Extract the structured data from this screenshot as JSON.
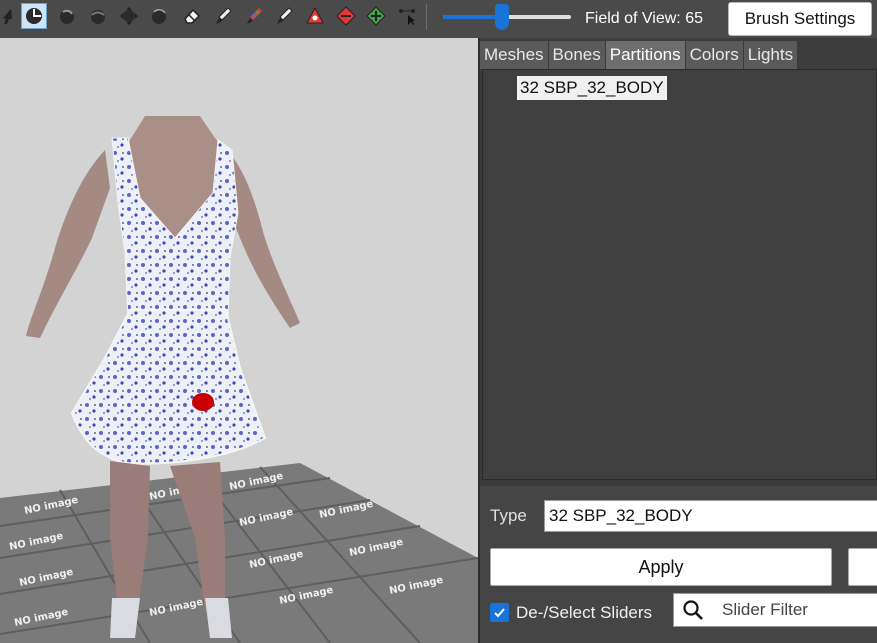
{
  "toolbar": {
    "tools": [
      {
        "icon": "select-icon",
        "active": false
      },
      {
        "icon": "transform-icon",
        "active": true
      },
      {
        "icon": "rotate-icon",
        "active": false
      },
      {
        "icon": "smooth-icon",
        "active": false
      },
      {
        "icon": "move-icon",
        "active": false
      },
      {
        "icon": "inflate-icon",
        "active": false
      },
      {
        "icon": "eraser-icon",
        "active": false
      },
      {
        "icon": "weight-brush-icon",
        "active": false
      },
      {
        "icon": "color-brush-icon",
        "active": false
      },
      {
        "icon": "alpha-brush-icon",
        "active": false
      },
      {
        "icon": "pivot-icon",
        "active": false
      },
      {
        "icon": "vertex-collapse-icon",
        "active": false
      },
      {
        "icon": "vertex-flip-icon",
        "active": false
      },
      {
        "icon": "move-vertex-icon",
        "active": false
      }
    ],
    "fov_slider_fraction": 0.46,
    "fov_label": "Field of View: 65",
    "brush_settings_label": "Brush Settings"
  },
  "tabs": [
    {
      "label": "Meshes",
      "active": false
    },
    {
      "label": "Bones",
      "active": false
    },
    {
      "label": "Partitions",
      "active": true
    },
    {
      "label": "Colors",
      "active": false
    },
    {
      "label": "Lights",
      "active": false
    }
  ],
  "partitions": {
    "items": [
      "32 SBP_32_BODY"
    ]
  },
  "partition_editor": {
    "type_label": "Type",
    "type_value": "32 SBP_32_BODY",
    "apply_label": "Apply",
    "select_sliders_label": "De-/Select Sliders",
    "select_sliders_checked": true,
    "slider_filter_placeholder": "Slider Filter"
  },
  "viewport": {
    "floor_tile_text": "NO image"
  },
  "colors": {
    "accent": "#1a73d6",
    "viewport_bg": "#d3d3d3",
    "panel_bg": "#3c3c3c"
  }
}
